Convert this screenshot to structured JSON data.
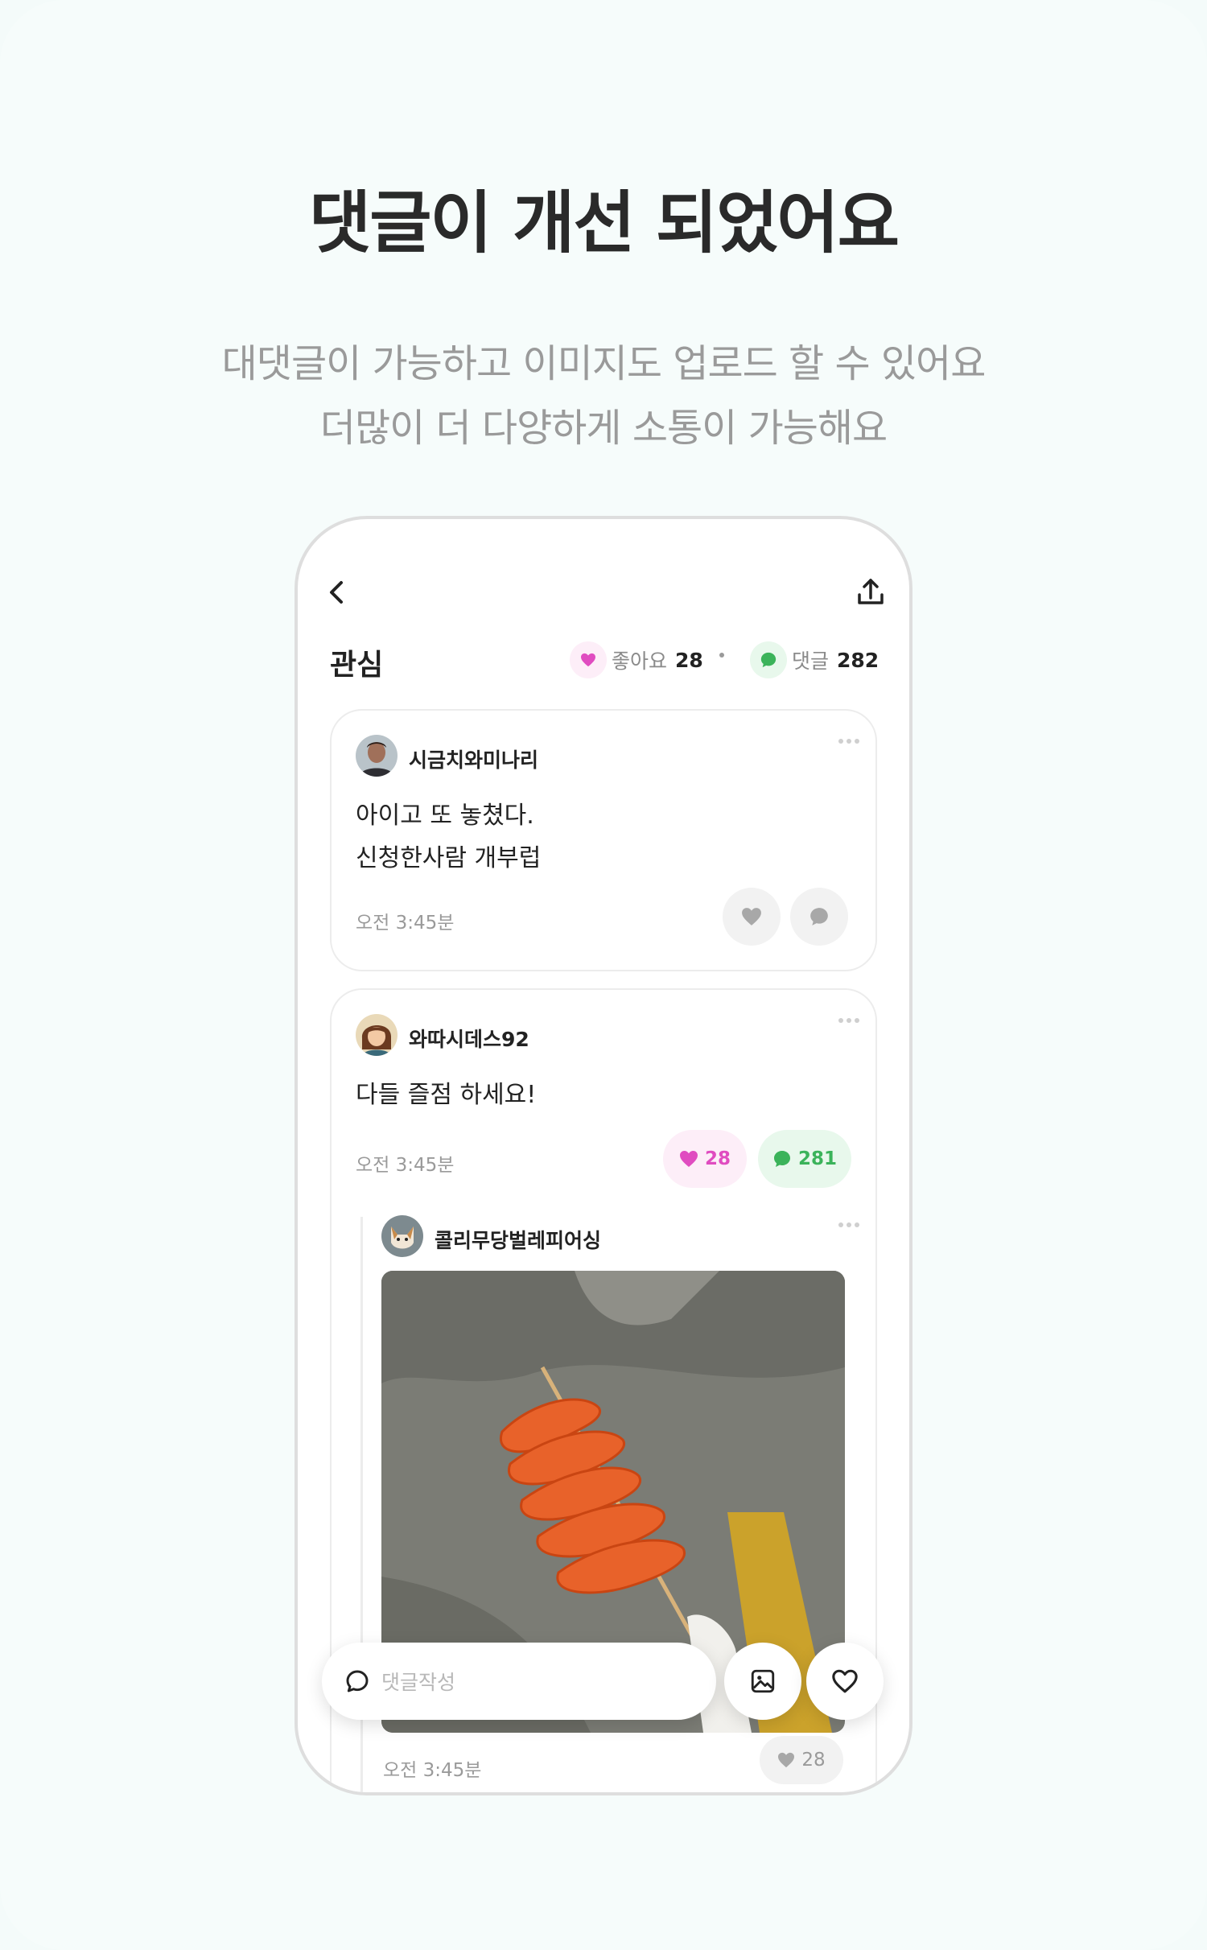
{
  "headline": "댓글이 개선 되었어요",
  "subline1": "대댓글이 가능하고 이미지도 업로드 할 수 있어요",
  "subline2": "더많이 더 다양하게 소통이 가능해요",
  "screen": {
    "title": "관심",
    "likes_label": "좋아요",
    "likes_count": "28",
    "comments_label": "댓글",
    "comments_count": "282",
    "comments": [
      {
        "username": "시금치와미나리",
        "line1": "아이고 또 놓쳤다.",
        "line2": "신청한사람 개부럽",
        "time": "오전 3:45분"
      },
      {
        "username": "와따시데스92",
        "line1": "다들 즐점 하세요!",
        "time": "오전 3:45분",
        "likes": "28",
        "replies": "281"
      }
    ],
    "reply": {
      "username": "콜리무당벌레피어싱",
      "time": "오전 3:45분",
      "likes": "28"
    },
    "composer_placeholder": "댓글작성"
  },
  "colors": {
    "like_accent": "#e04cc0",
    "comment_accent": "#3bb35a",
    "page_background": "#f6fcfb"
  },
  "icons": [
    "back-icon",
    "share-icon",
    "heart-icon",
    "chat-bubble-icon",
    "more-icon",
    "image-icon",
    "search-bubble-icon"
  ]
}
